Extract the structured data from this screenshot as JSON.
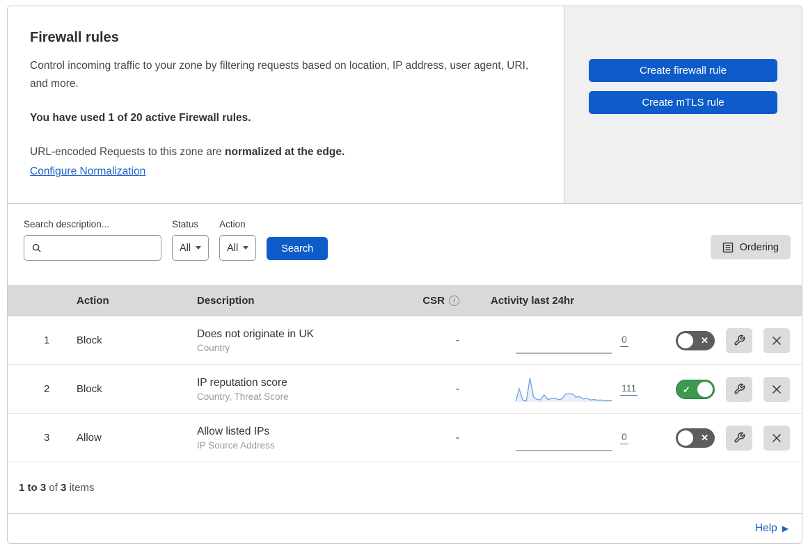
{
  "header": {
    "title": "Firewall rules",
    "description": "Control incoming traffic to your zone by filtering requests based on location, IP address, user agent, URI, and more.",
    "usage_notice": "You have used 1 of 20 active Firewall rules.",
    "normalization_prefix": "URL-encoded Requests to this zone are ",
    "normalization_bold": "normalized at the edge.",
    "normalization_link": "Configure Normalization"
  },
  "actions_panel": {
    "create_firewall_rule_label": "Create firewall rule",
    "create_mtls_rule_label": "Create mTLS rule"
  },
  "filters": {
    "search_label": "Search description...",
    "search_value": "",
    "status_label": "Status",
    "status_value": "All",
    "action_label": "Action",
    "action_value": "All",
    "search_button_label": "Search",
    "ordering_button_label": "Ordering"
  },
  "table": {
    "columns": {
      "action": "Action",
      "description": "Description",
      "csr": "CSR",
      "activity": "Activity last 24hr"
    },
    "rows": [
      {
        "priority": "1",
        "action": "Block",
        "description": "Does not originate in UK",
        "fields": "Country",
        "csr": "-",
        "activity_count": "0",
        "enabled": false
      },
      {
        "priority": "2",
        "action": "Block",
        "description": "IP reputation score",
        "fields": "Country, Threat Score",
        "csr": "-",
        "activity_count": "111",
        "enabled": true
      },
      {
        "priority": "3",
        "action": "Allow",
        "description": "Allow listed IPs",
        "fields": "IP Source Address",
        "csr": "-",
        "activity_count": "0",
        "enabled": false
      }
    ]
  },
  "chart_data": [
    {
      "type": "area",
      "title": "Activity last 24hr - rule 1 (Does not originate in UK)",
      "total": 0,
      "values": [
        0,
        0,
        0,
        0,
        0,
        0,
        0,
        0,
        0,
        0,
        0,
        0,
        0,
        0,
        0,
        0,
        0,
        0,
        0,
        0,
        0,
        0,
        0,
        0
      ]
    },
    {
      "type": "area",
      "title": "Activity last 24hr - rule 2 (IP reputation score)",
      "total": 111,
      "values": [
        3,
        55,
        8,
        4,
        100,
        22,
        10,
        9,
        30,
        10,
        14,
        16,
        10,
        12,
        33,
        35,
        33,
        20,
        22,
        12,
        16,
        8,
        10,
        7,
        8,
        6,
        6,
        6
      ],
      "line_color": "#7aa3e3",
      "fill_color": "#e8f0fa"
    },
    {
      "type": "area",
      "title": "Activity last 24hr - rule 3 (Allow listed IPs)",
      "total": 0,
      "values": [
        0,
        0,
        0,
        0,
        0,
        0,
        0,
        0,
        0,
        0,
        0,
        0,
        0,
        0,
        0,
        0,
        0,
        0,
        0,
        0,
        0,
        0,
        0,
        0
      ]
    }
  ],
  "pagination": {
    "range": "1 to 3",
    "of": "of",
    "total": "3",
    "items": "items"
  },
  "footer": {
    "help_label": "Help"
  },
  "colors": {
    "primary_blue": "#0d5cca",
    "link_blue": "#2061c5",
    "toggle_on_green": "#3b9a50",
    "toggle_off_gray": "#5d5d5d",
    "table_header_gray": "#d9d9d9",
    "panel_gray": "#f0f0f0",
    "sparkline_blue": "#7aa3e3"
  }
}
